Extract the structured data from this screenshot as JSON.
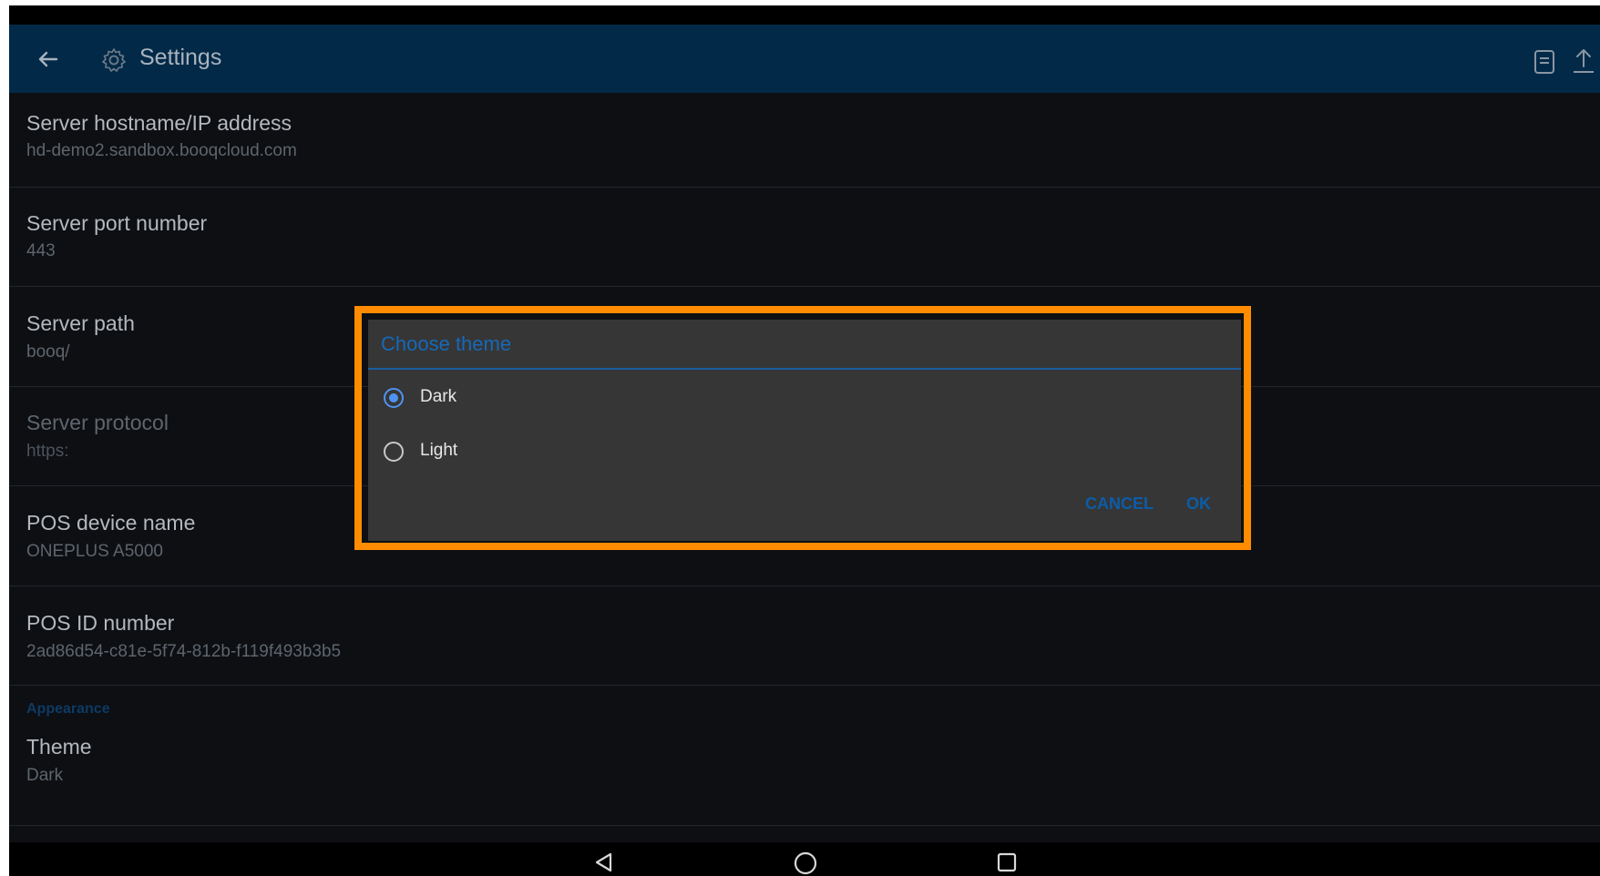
{
  "app": {
    "title": "Settings"
  },
  "preferences": [
    {
      "title": "Server hostname/IP address",
      "summary": "hd-demo2.sandbox.booqcloud.com"
    },
    {
      "title": "Server port number",
      "summary": "443"
    },
    {
      "title": "Server path",
      "summary": "booq/"
    },
    {
      "title": "Server protocol",
      "summary": "https:"
    },
    {
      "title": "POS device name",
      "summary": "ONEPLUS A5000"
    },
    {
      "title": "POS ID number",
      "summary": "2ad86d54-c81e-5f74-812b-f119f493b3b5"
    }
  ],
  "appearance": {
    "header": "Appearance",
    "theme_title": "Theme",
    "theme_value": "Dark"
  },
  "dialog": {
    "title": "Choose theme",
    "options": [
      {
        "label": "Dark",
        "selected": true
      },
      {
        "label": "Light",
        "selected": false
      }
    ],
    "cancel_label": "CANCEL",
    "ok_label": "OK"
  },
  "colors": {
    "appbar": "#022a48",
    "background": "#0d0f13",
    "dialog_bg": "#363636",
    "accent": "#1669b8",
    "highlight": "#ff8c00"
  },
  "icons": {
    "back": "arrow-left-icon",
    "settings": "gear-icon",
    "doc": "document-icon",
    "upload": "upload-icon",
    "nav_back": "triangle-back-icon",
    "nav_home": "circle-home-icon",
    "nav_recents": "square-recents-icon"
  }
}
